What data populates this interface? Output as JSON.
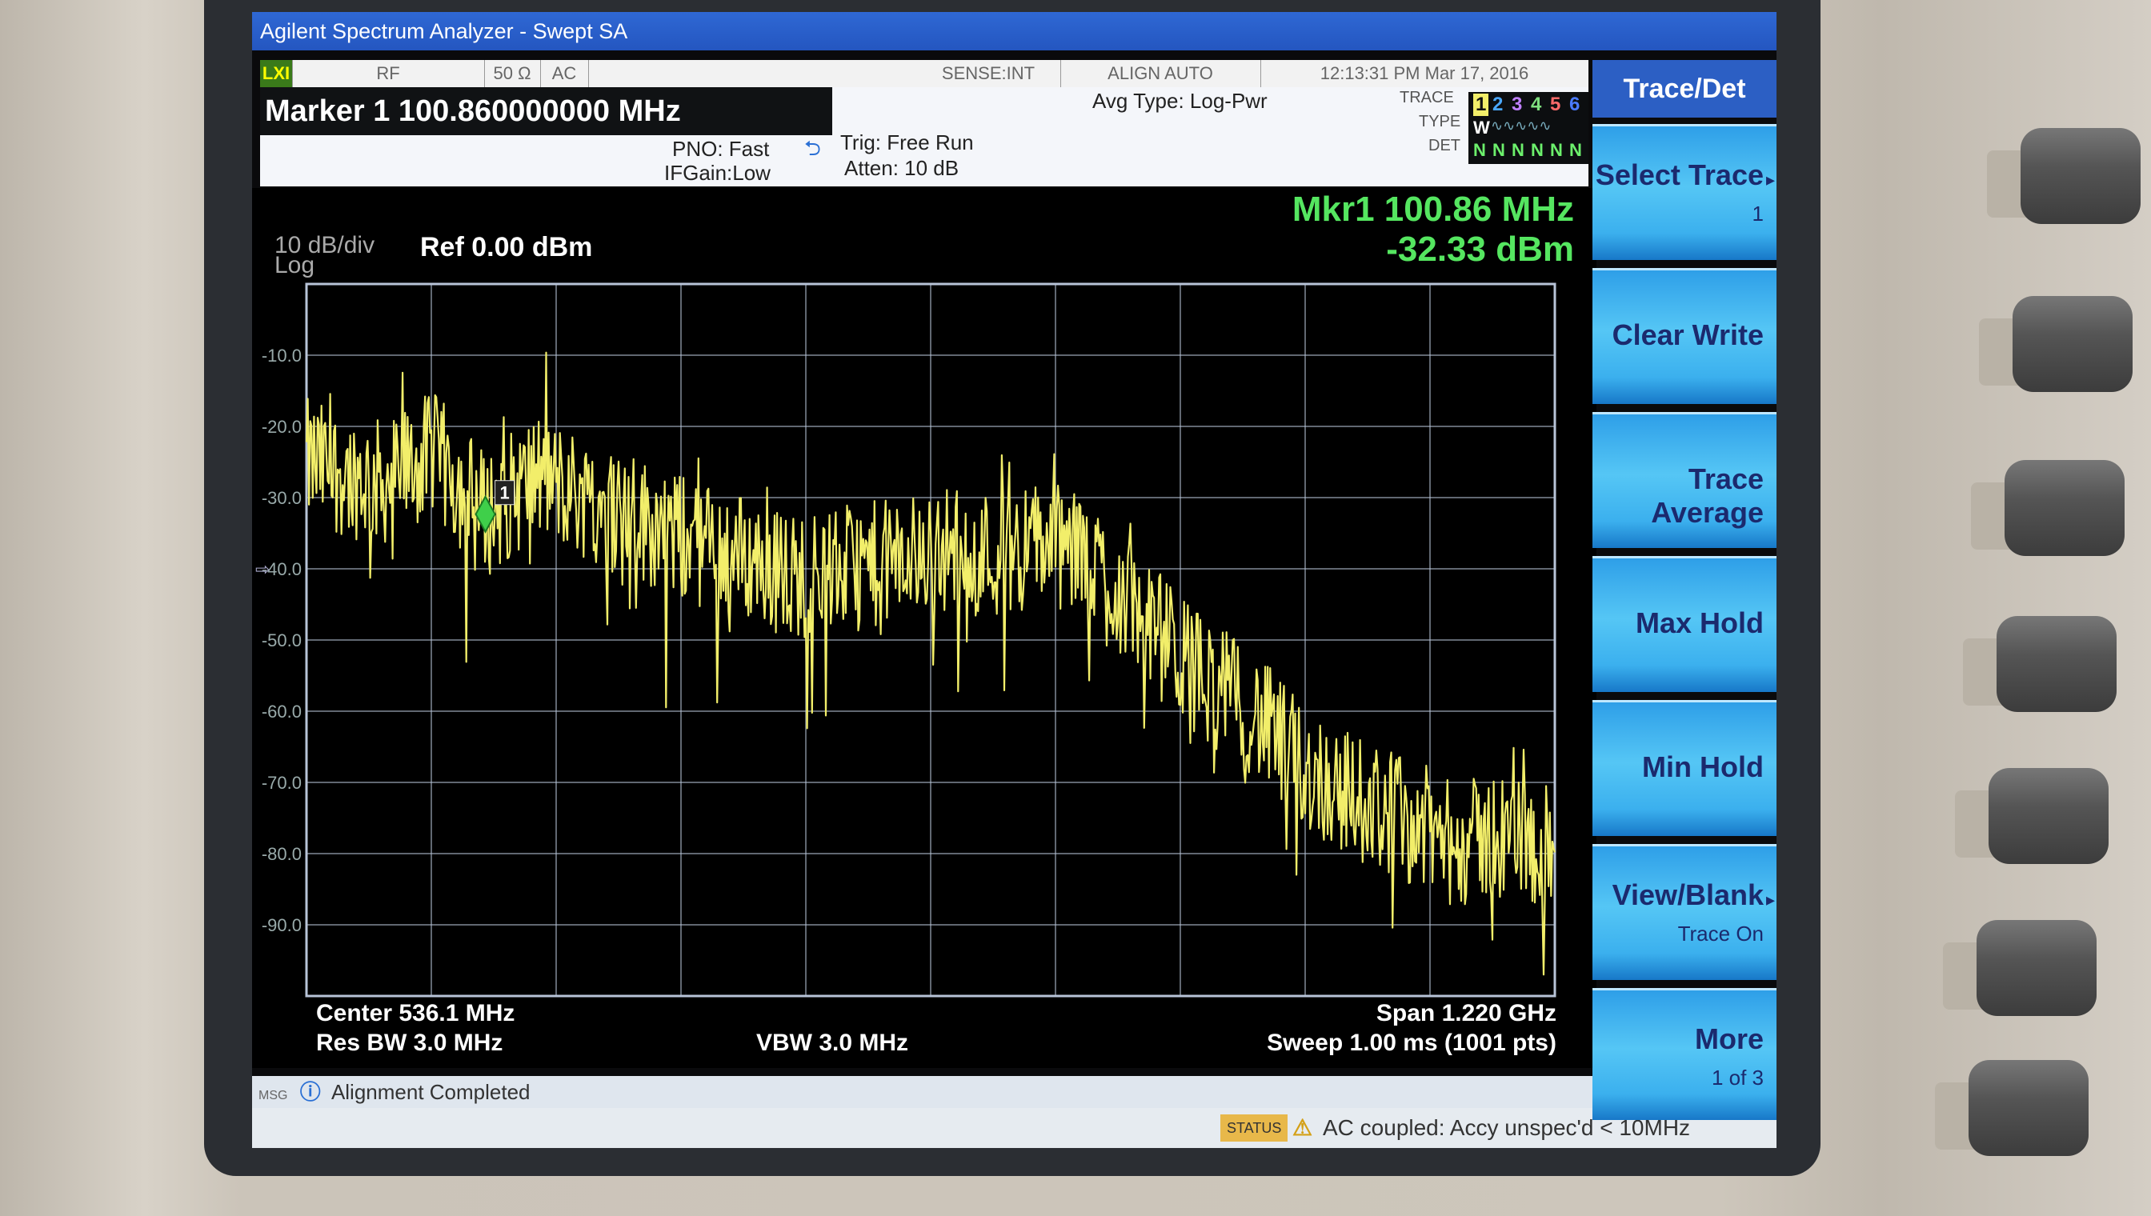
{
  "window": {
    "title": "Agilent Spectrum Analyzer - Swept SA"
  },
  "status_bar_top": {
    "rf": "RF",
    "impedance": "50 Ω",
    "coupling": "AC",
    "sense": "SENSE:INT",
    "align": "ALIGN AUTO",
    "datetime": "12:13:31 PM Mar 17, 2016"
  },
  "marker": {
    "label": "Marker 1 100.860000000 MHz",
    "readout_freq": "Mkr1 100.86 MHz",
    "readout_level": "-32.33 dBm",
    "id": "1"
  },
  "settings": {
    "pno": "PNO: Fast",
    "ifgain": "IFGain:Low",
    "trig": "Trig: Free Run",
    "atten": "Atten: 10 dB",
    "avg_type": "Avg Type: Log-Pwr"
  },
  "trace_panel": {
    "trace_label": "TRACE",
    "type_label": "TYPE",
    "det_label": "DET",
    "traces": [
      "1",
      "2",
      "3",
      "4",
      "5",
      "6"
    ],
    "type_value": "W",
    "det_value": "N N N N N N"
  },
  "plot": {
    "scale": "10 dB/div",
    "scale_mode": "Log",
    "ref_level": "Ref 0.00 dBm",
    "y_ticks": [
      "-10.0",
      "-20.0",
      "-30.0",
      "-40.0",
      "-50.0",
      "-60.0",
      "-70.0",
      "-80.0",
      "-90.0"
    ],
    "center": "Center 536.1 MHz",
    "res_bw": "Res BW 3.0 MHz",
    "vbw": "VBW 3.0 MHz",
    "span": "Span 1.220 GHz",
    "sweep": "Sweep  1.00 ms (1001 pts)",
    "trace_color": "#f2ee6a",
    "grid_color": "#b8c4d8"
  },
  "softkeys": {
    "title": "Trace/Det",
    "keys": [
      {
        "label": "Select Trace",
        "sub": "1",
        "arrow": "▸"
      },
      {
        "label": "Clear Write",
        "sub": ""
      },
      {
        "label": "Trace Average",
        "sub": ""
      },
      {
        "label": "Max Hold",
        "sub": ""
      },
      {
        "label": "Min Hold",
        "sub": ""
      },
      {
        "label": "View/Blank",
        "sub": "Trace On",
        "arrow": "▸"
      },
      {
        "label": "More",
        "sub": "1 of 3"
      }
    ]
  },
  "messages": {
    "msg_tag": "MSG",
    "msg": "Alignment Completed",
    "status_tag": "STATUS",
    "status": "AC coupled: Accy unspec'd < 10MHz"
  },
  "chart_data": {
    "type": "line",
    "xlabel": "",
    "ylabel": "",
    "x_range_mhz": [
      -74,
      1146.1
    ],
    "ylim": [
      -100,
      0
    ],
    "y_unit": "dBm",
    "series": [
      {
        "x": [
          -74,
          0,
          50,
          100.86,
          150,
          200,
          250,
          300,
          350,
          400,
          450,
          500,
          550,
          600,
          650,
          700,
          750,
          800,
          850,
          900,
          950,
          1000,
          1050,
          1100,
          1146.1
        ],
        "y": [
          -25,
          -28,
          -24,
          -32.33,
          -27,
          -30,
          -33,
          -36,
          -38,
          -41,
          -40,
          -39,
          -37,
          -38,
          -36,
          -40,
          -48,
          -55,
          -60,
          -68,
          -72,
          -75,
          -79,
          -77,
          -80
        ]
      }
    ],
    "marker": {
      "x": 100.86,
      "y": -32.33
    },
    "grid": true
  }
}
